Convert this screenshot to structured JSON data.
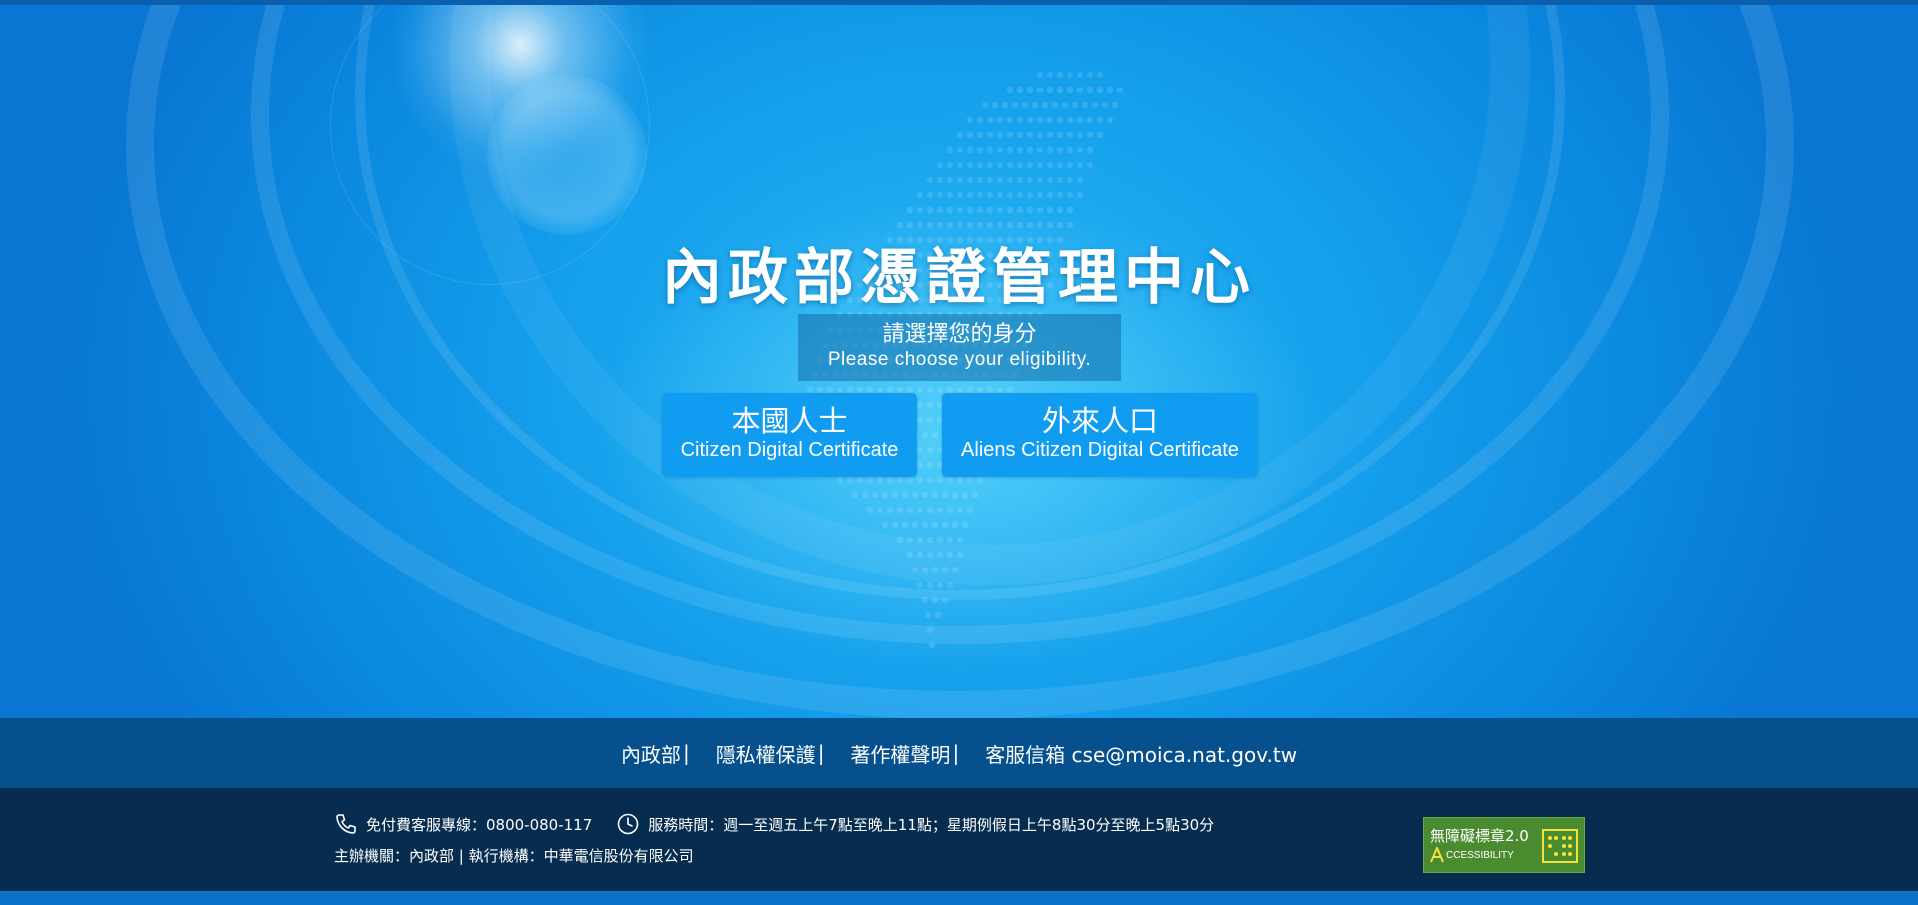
{
  "header": {
    "title": "內政部憑證管理中心",
    "prompt_zh": "請選擇您的身分",
    "prompt_en": "Please choose your eligibility."
  },
  "options": [
    {
      "label_zh": "本國人士",
      "label_en": "Citizen Digital Certificate"
    },
    {
      "label_zh": "外來人口",
      "label_en": "Aliens Citizen Digital Certificate"
    }
  ],
  "footer_links": {
    "moi": "內政部",
    "privacy": "隱私權保護",
    "copyright": "著作權聲明",
    "email_label": "客服信箱 cse@moica.nat.gov.tw",
    "separator": "|"
  },
  "footer_info": {
    "hotline": "免付費客服專線：0800-080-117",
    "service_hours": "服務時間：週一至週五上午7點至晚上11點；星期例假日上午8點30分至晚上5點30分",
    "organizers": "主辦機關：內政部 | 執行機構：中華電信股份有限公司"
  },
  "badge": {
    "title": "無障礙標章2.0",
    "subtitle": "CCESSIBILITY"
  },
  "colors": {
    "hero_blue": "#159fec",
    "button_blue": "#109cf0",
    "links_bar": "#06508e",
    "info_bar": "#062c4f",
    "badge_green": "#4b8b2f"
  },
  "icons": {
    "phone": "phone-icon",
    "clock": "clock-icon",
    "accessibility": "accessibility-badge-icon"
  }
}
